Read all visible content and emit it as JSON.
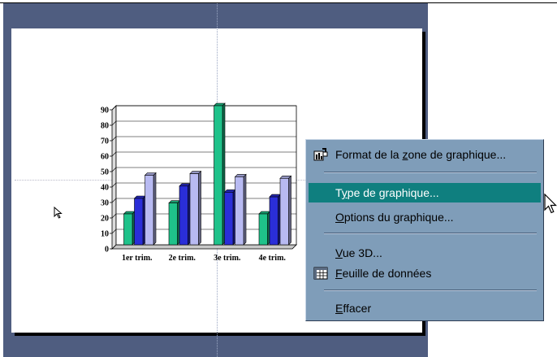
{
  "context_menu": {
    "items": [
      {
        "pre": "Format de la ",
        "key": "z",
        "post": "one de graphique...",
        "icon": "chart-area-format-icon"
      },
      {
        "pre": "T",
        "key": "y",
        "post": "pe de graphique...",
        "highlighted": true
      },
      {
        "pre": "",
        "key": "O",
        "post": "ptions du graphique..."
      },
      {
        "pre": "",
        "key": "V",
        "post": "ue 3D..."
      },
      {
        "pre": "",
        "key": "F",
        "post": "euille de données",
        "icon": "datasheet-icon"
      },
      {
        "pre": "",
        "key": "E",
        "post": "ffacer"
      }
    ]
  },
  "chart_data": {
    "type": "bar",
    "categories": [
      "1er trim.",
      "2e trim.",
      "3e trim.",
      "4e trim."
    ],
    "series": [
      {
        "values": [
          20,
          27,
          90,
          20
        ],
        "color": "#1fc28a"
      },
      {
        "values": [
          30,
          38,
          34,
          31
        ],
        "color": "#2a2ed8"
      },
      {
        "values": [
          45,
          46,
          44,
          43
        ],
        "color": "#b8baf2"
      }
    ],
    "ylim": [
      0,
      90
    ],
    "yticks": [
      "0",
      "10",
      "20",
      "30",
      "40",
      "50",
      "60",
      "70",
      "80",
      "90"
    ],
    "grid": true,
    "style": "3d-clustered-column"
  }
}
